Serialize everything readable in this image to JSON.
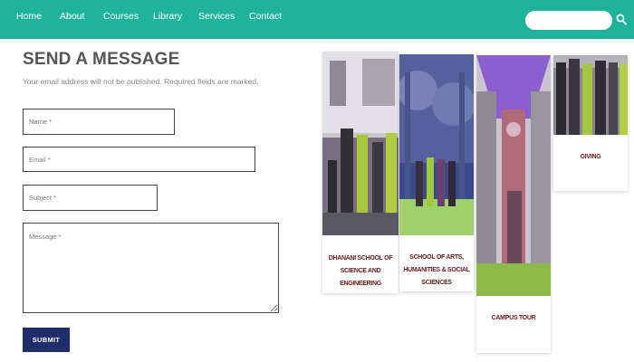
{
  "nav": {
    "items": [
      "Home",
      "About",
      "Courses",
      "Library",
      "Services",
      "Contact"
    ],
    "search_placeholder": "",
    "bg_color": "#20b39b"
  },
  "form": {
    "title": "SEND A MESSAGE",
    "subtitle": "Your email address will not be published. Required fields are marked.",
    "name_placeholder": "Name *",
    "email_placeholder": "Email *",
    "subject_placeholder": "Subject *",
    "message_placeholder": "Message *",
    "submit_label": "SUBMIT",
    "submit_color": "#1f2d6b"
  },
  "cards": [
    {
      "label": "DHANANI SCHOOL OF SCIENCE AND ENGINEERING"
    },
    {
      "label": "SCHOOL OF ARTS, HUMANITIES & SOCIAL SCIENCES"
    },
    {
      "label": "CAMPUS TOUR"
    },
    {
      "label": "GIVING"
    }
  ]
}
